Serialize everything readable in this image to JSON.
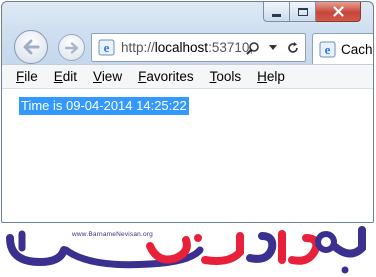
{
  "window": {
    "caption_buttons": [
      "minimize",
      "maximize",
      "close"
    ]
  },
  "navigation": {
    "back_icon": "back-arrow-icon",
    "forward_icon": "forward-arrow-icon"
  },
  "address_bar": {
    "url_prefix": "http://",
    "url_host": "localhost",
    "url_rest": ":53710,",
    "site_icon": "ie-page-icon",
    "tools": [
      "search-icon",
      "dropdown-arrow-icon",
      "refresh-icon"
    ]
  },
  "tab": {
    "label": "Cach",
    "icon": "ie-page-icon"
  },
  "menu": {
    "items": [
      "File",
      "Edit",
      "View",
      "Favorites",
      "Tools",
      "Help"
    ]
  },
  "content": {
    "selected_text": "Time is 09-04-2014 14:25:22"
  },
  "watermark": {
    "url": "www.BarnameNevisan.org",
    "logo_text": "برنامه نویسان",
    "colors": {
      "red": "#e8203a",
      "purple": "#3b2f8f"
    }
  },
  "colors": {
    "selection": "#3399ff",
    "close_button": "#c7473a",
    "frame": "#cfdff0"
  }
}
